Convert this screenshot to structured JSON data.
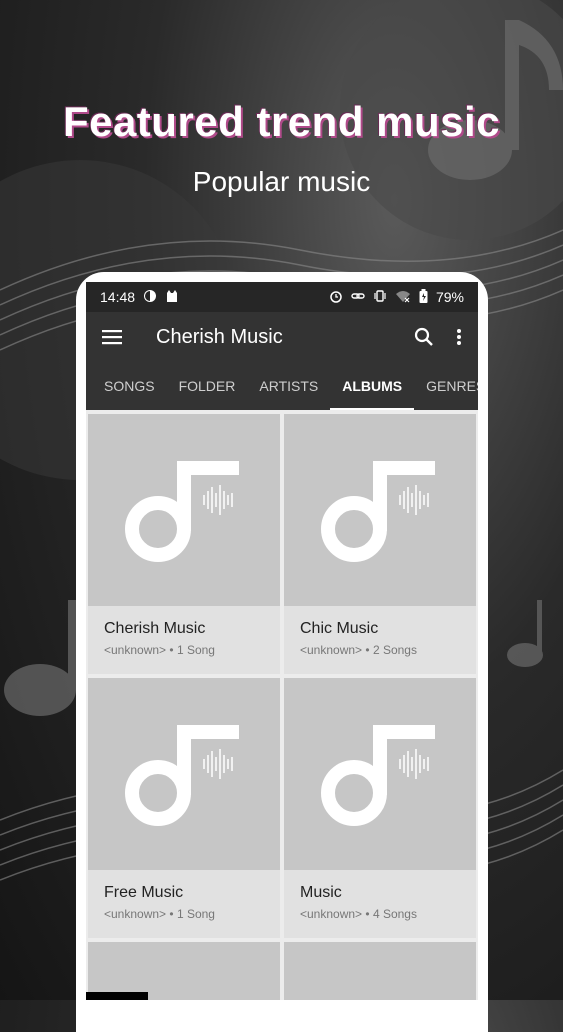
{
  "promo": {
    "headline": "Featured trend music",
    "subline": "Popular music"
  },
  "status_bar": {
    "time": "14:48",
    "battery": "79%"
  },
  "app_bar": {
    "title": "Cherish Music",
    "menu_icon": "hamburger-menu-icon",
    "search_icon": "search-icon",
    "more_icon": "more-vert-icon"
  },
  "tabs": [
    {
      "label": "SONGS",
      "active": false
    },
    {
      "label": "FOLDER",
      "active": false
    },
    {
      "label": "ARTISTS",
      "active": false
    },
    {
      "label": "ALBUMS",
      "active": true
    },
    {
      "label": "GENRES",
      "active": false
    }
  ],
  "albums": [
    {
      "name": "Cherish Music",
      "artist": "<unknown>",
      "songs": "1 Song"
    },
    {
      "name": "Chic Music",
      "artist": "<unknown>",
      "songs": "2 Songs"
    },
    {
      "name": "Free Music",
      "artist": "<unknown>",
      "songs": "1 Song"
    },
    {
      "name": "Music",
      "artist": "<unknown>",
      "songs": "4 Songs"
    }
  ],
  "colors": {
    "app_bar": "#333333",
    "status_bar": "#262626",
    "card": "#e1e1e1",
    "album_art": "#c6c6c6"
  }
}
